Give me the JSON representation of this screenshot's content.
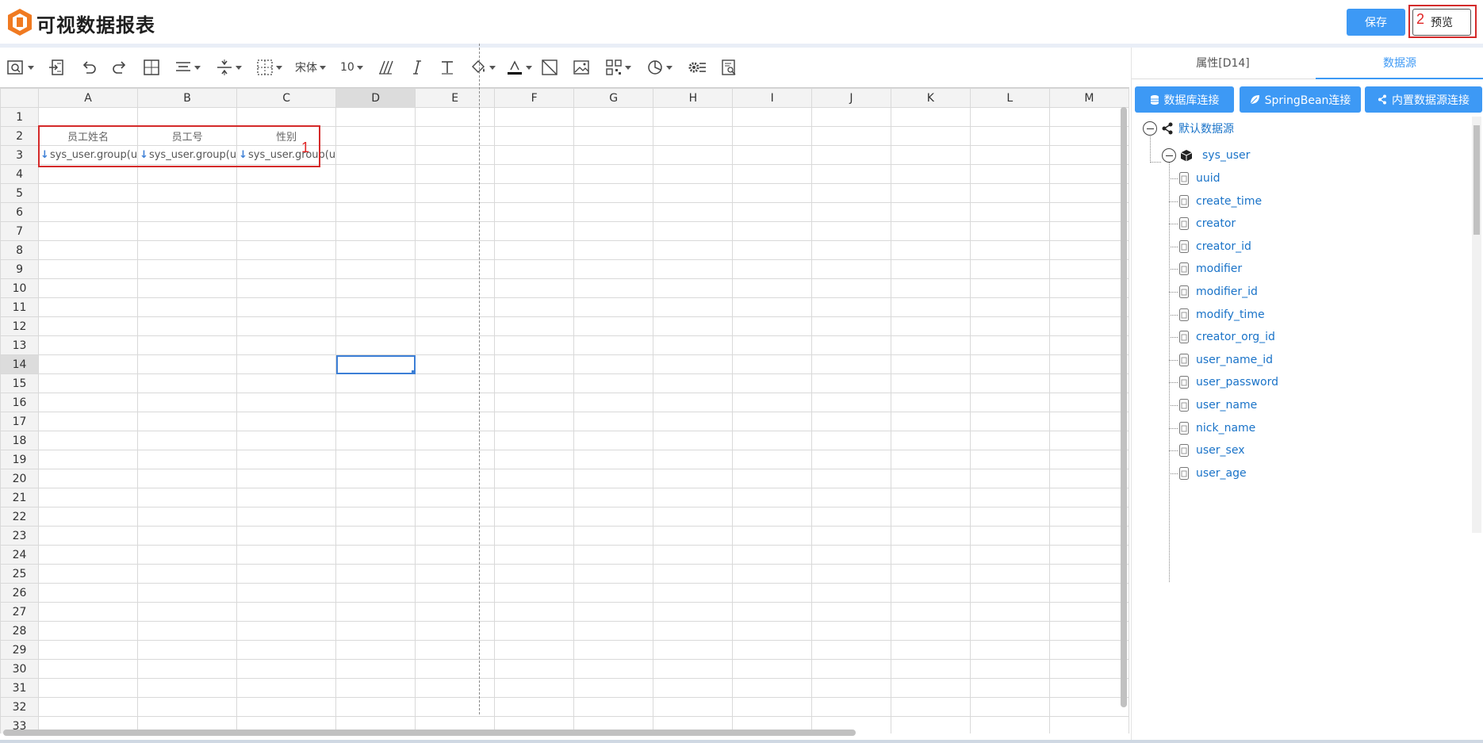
{
  "app": {
    "title": "可视数据报表"
  },
  "header": {
    "save_label": "保存",
    "preview_label": "预览",
    "marker_preview": "2"
  },
  "toolbar": {
    "font_name": "宋体",
    "font_size": "10"
  },
  "sheet": {
    "columns": [
      "A",
      "B",
      "C",
      "D",
      "E",
      "F",
      "G",
      "H",
      "I",
      "J",
      "K",
      "L",
      "M"
    ],
    "active_column": "D",
    "rows": [
      "1",
      "2",
      "3",
      "4",
      "5",
      "6",
      "7",
      "8",
      "9",
      "10",
      "11",
      "12",
      "13",
      "14",
      "15",
      "16",
      "17",
      "18",
      "19",
      "20",
      "21",
      "22",
      "23",
      "24",
      "25",
      "26",
      "27",
      "28",
      "29",
      "30",
      "31",
      "32",
      "33"
    ],
    "active_row": "14",
    "header_cells": [
      "员工姓名",
      "员工号",
      "性别"
    ],
    "field_cells": [
      "sys_user.group(u",
      "sys_user.group(u",
      "sys_user.group(u"
    ],
    "marker_cells": "1"
  },
  "panel": {
    "tabs": [
      "属性[D14]",
      "数据源"
    ],
    "active_tab": "数据源",
    "buttons": [
      "数据库连接",
      "SpringBean连接",
      "内置数据源连接"
    ],
    "tree": {
      "root": "默认数据源",
      "table": "sys_user",
      "fields": [
        "uuid",
        "create_time",
        "creator",
        "creator_id",
        "modifier",
        "modifier_id",
        "modify_time",
        "creator_org_id",
        "user_name_id",
        "user_password",
        "user_name",
        "nick_name",
        "user_sex",
        "user_age"
      ]
    }
  },
  "colors": {
    "accent": "#3d99f5",
    "highlight": "#d42a2a",
    "tree_link": "#1a73c8"
  }
}
